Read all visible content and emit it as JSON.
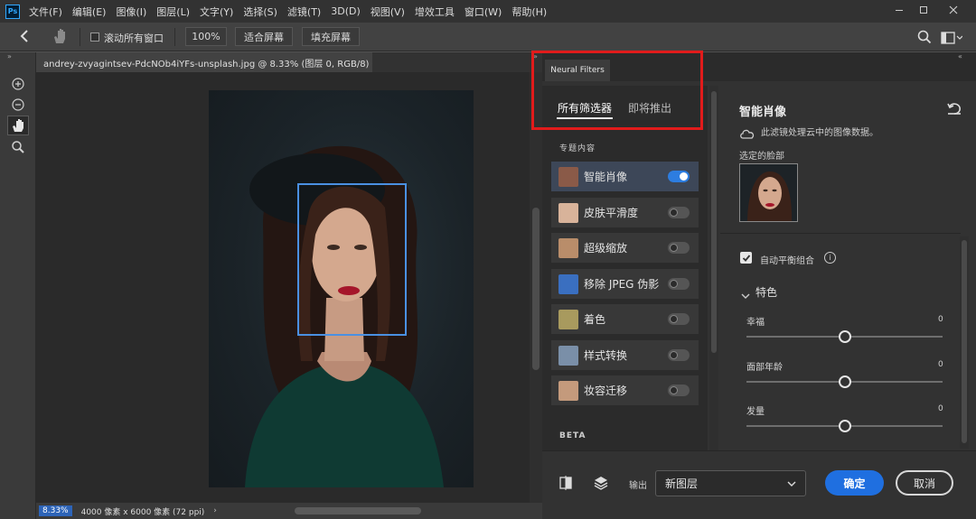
{
  "app": {
    "logo_text": "Ps",
    "menu": [
      "文件(F)",
      "编辑(E)",
      "图像(I)",
      "图层(L)",
      "文字(Y)",
      "选择(S)",
      "滤镜(T)",
      "3D(D)",
      "视图(V)",
      "增效工具",
      "窗口(W)",
      "帮助(H)"
    ]
  },
  "options_bar": {
    "scroll_all_windows": "滚动所有窗口",
    "zoom_100": "100%",
    "fit_screen": "适合屏幕",
    "fill_screen": "填充屏幕"
  },
  "document": {
    "tab_title": "andrey-zvyagintsev-PdcNOb4iYFs-unsplash.jpg @ 8.33% (图层 0, RGB/8) *",
    "tab_close": "×",
    "zoom": "8.33%",
    "dimensions": "4000 像素 x 6000 像素 (72 ppi)",
    "status_arrow": "›"
  },
  "neural_filters": {
    "panel_title": "Neural Filters",
    "tabs": {
      "all": "所有筛选器",
      "coming_soon": "即将推出"
    },
    "section_featured": "专题内容",
    "section_beta": "BETA",
    "filters": [
      {
        "label": "智能肖像",
        "on": true,
        "thumb": "#8a5a48"
      },
      {
        "label": "皮肤平滑度",
        "on": false,
        "thumb": "#d8b39a"
      },
      {
        "label": "超级缩放",
        "on": false,
        "thumb": "#b98d6a"
      },
      {
        "label": "移除 JPEG 伪影",
        "on": false,
        "thumb": "#3a6fc0"
      },
      {
        "label": "着色",
        "on": false,
        "thumb": "#a89a5e"
      },
      {
        "label": "样式转换",
        "on": false,
        "thumb": "#7a8fa8"
      },
      {
        "label": "妆容迁移",
        "on": false,
        "thumb": "#c49a7c"
      }
    ],
    "detail": {
      "title": "智能肖像",
      "cloud_note": "此滤镜处理云中的图像数据。",
      "selected_face_label": "选定的脸部",
      "auto_balance": "自动平衡组合",
      "features_label": "特色",
      "sliders": [
        {
          "label": "幸福",
          "value": "0",
          "position": 0.5
        },
        {
          "label": "面部年龄",
          "value": "0",
          "position": 0.5
        },
        {
          "label": "发量",
          "value": "0",
          "position": 0.5
        }
      ]
    },
    "bottom": {
      "output_label": "输出",
      "output_value": "新图层",
      "ok": "确定",
      "cancel": "取消"
    }
  }
}
